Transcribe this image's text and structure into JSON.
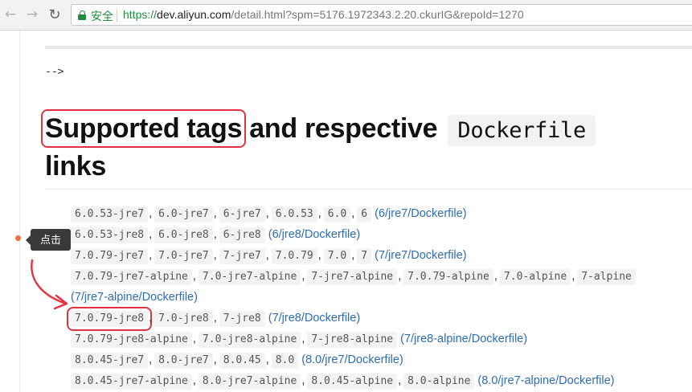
{
  "browser": {
    "secure_label": "安全",
    "url_scheme": "https://",
    "url_host": "dev.aliyun.com",
    "url_path": "/detail.html?spm=5176.1972343.2.20.ckurIG&repoId=1270"
  },
  "page": {
    "comment_end": "-->",
    "heading_boxed": "Supported tags",
    "heading_rest": "and respective",
    "heading_code": "Dockerfile",
    "heading_line2": "links"
  },
  "annotation": {
    "tooltip": "点击",
    "accent_color": "#e53242"
  },
  "tag_rows": [
    {
      "tags": [
        "6.0.53-jre7",
        "6.0-jre7",
        "6-jre7",
        "6.0.53",
        "6.0",
        "6"
      ],
      "link": "(6/jre7/Dockerfile)"
    },
    {
      "tags": [
        "6.0.53-jre8",
        "6.0-jre8",
        "6-jre8"
      ],
      "link": "(6/jre8/Dockerfile)"
    },
    {
      "tags": [
        "7.0.79-jre7",
        "7.0-jre7",
        "7-jre7",
        "7.0.79",
        "7.0",
        "7"
      ],
      "link": "(7/jre7/Dockerfile)"
    },
    {
      "tags": [
        "7.0.79-jre7-alpine",
        "7.0-jre7-alpine",
        "7-jre7-alpine",
        "7.0.79-alpine",
        "7.0-alpine",
        "7-alpine"
      ],
      "link": "(7/jre7-alpine/Dockerfile)"
    },
    {
      "tags": [
        "7.0.79-jre8",
        "7.0-jre8",
        "7-jre8"
      ],
      "link": "(7/jre8/Dockerfile)"
    },
    {
      "tags": [
        "7.0.79-jre8-alpine",
        "7.0-jre8-alpine",
        "7-jre8-alpine"
      ],
      "link": "(7/jre8-alpine/Dockerfile)"
    },
    {
      "tags": [
        "8.0.45-jre7",
        "8.0-jre7",
        "8.0.45",
        "8.0"
      ],
      "link": "(8.0/jre7/Dockerfile)"
    },
    {
      "tags": [
        "8.0.45-jre7-alpine",
        "8.0-jre7-alpine",
        "8.0.45-alpine",
        "8.0-alpine"
      ],
      "link": "(8.0/jre7-alpine/Dockerfile)"
    }
  ]
}
